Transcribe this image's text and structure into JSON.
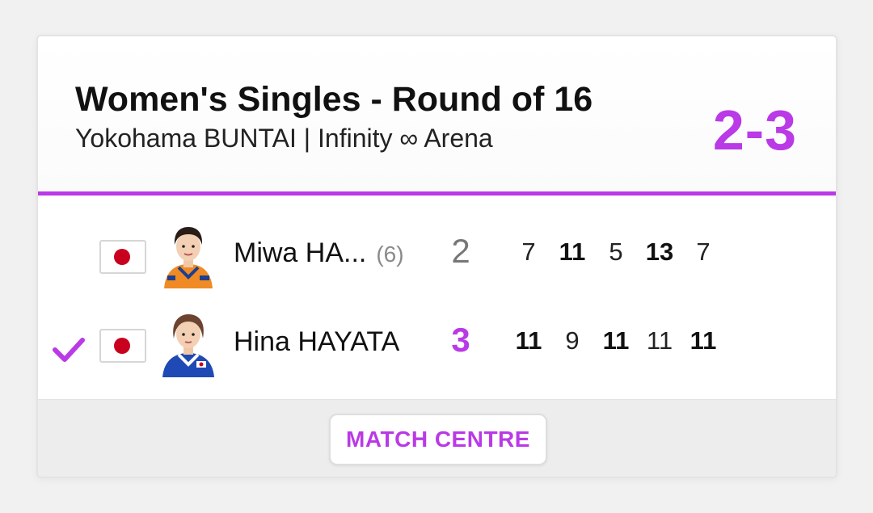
{
  "match": {
    "title": "Women's Singles - Round of 16",
    "venue": "Yokohama BUNTAI | Infinity ∞ Arena",
    "score": "2-3"
  },
  "players": [
    {
      "name": "Miwa HA...",
      "seed": "(6)",
      "country_flag": "japan-flag",
      "games_won": "2",
      "winner": false,
      "sets": [
        "7",
        "11",
        "5",
        "13",
        "7"
      ],
      "set_wins": [
        false,
        true,
        false,
        true,
        false
      ]
    },
    {
      "name": "Hina HAYATA",
      "seed": "",
      "country_flag": "japan-flag",
      "games_won": "3",
      "winner": true,
      "winner_icon": "checkmark-icon",
      "sets": [
        "11",
        "9",
        "11",
        "11",
        "11"
      ],
      "set_wins": [
        true,
        false,
        true,
        false,
        true
      ]
    }
  ],
  "footer": {
    "match_centre_label": "MATCH CENTRE"
  },
  "colors": {
    "accent": "#b93ae6",
    "flag_red": "#c8001e"
  }
}
